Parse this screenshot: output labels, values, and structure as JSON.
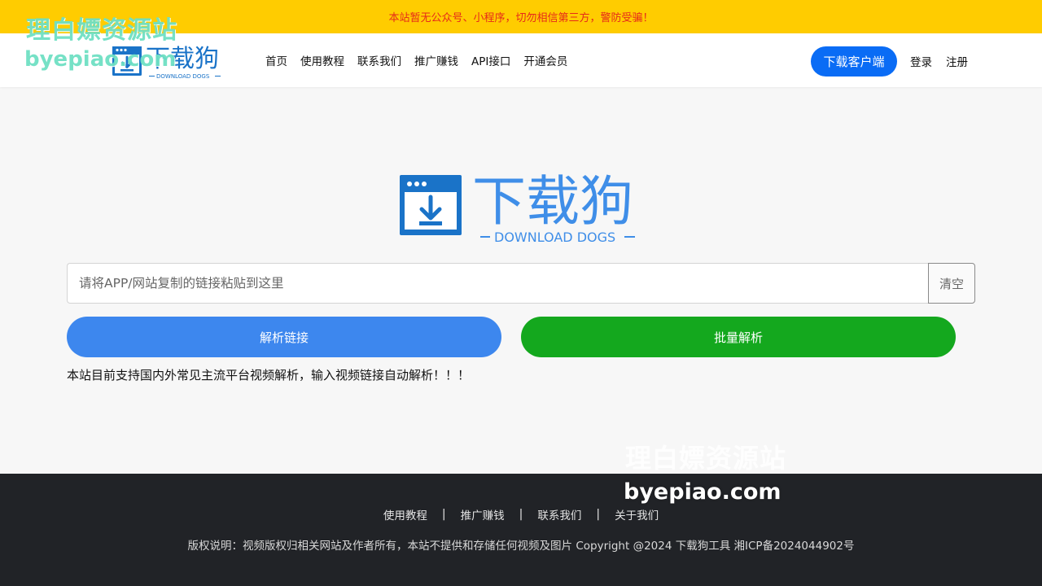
{
  "notice": {
    "text": "本站暂无公众号、小程序，切勿相信第三方，警防受骗！"
  },
  "watermark": {
    "cn": "理白嫖资源站",
    "en": "byepiao.com"
  },
  "logo": {
    "title": "下载狗",
    "subtitle": "DOWNLOAD DOGS"
  },
  "nav": {
    "items": [
      "首页",
      "使用教程",
      "联系我们",
      "推广赚钱",
      "API接口",
      "开通会员"
    ],
    "client_button": "下载客户端",
    "login": "登录",
    "register": "注册"
  },
  "search": {
    "placeholder": "请将APP/网站复制的链接粘贴到这里",
    "value": "",
    "clear_label": "清空"
  },
  "actions": {
    "parse_label": "解析链接",
    "batch_label": "批量解析"
  },
  "support_text": "本站目前支持国内外常见主流平台视频解析，输入视频链接自动解析！！！",
  "footer": {
    "links": [
      "使用教程",
      "推广赚钱",
      "联系我们",
      "关于我们"
    ],
    "separator": "|",
    "copyright": "版权说明：视频版权归相关网站及作者所有，本站不提供和存储任何视频及图片 Copyright @2024 下载狗工具 湘ICP备2024044902号"
  },
  "colors": {
    "notice_bg": "#ffcc00",
    "notice_text": "#e62a1a",
    "brand_blue": "#0a6cf5",
    "logo_blue": "#1a73c8",
    "parse_blue": "#3d87ee",
    "batch_green": "#14a81e",
    "footer_bg": "#212327",
    "watermark": "#6fe0c4"
  },
  "icons": [
    "download-window-icon"
  ]
}
